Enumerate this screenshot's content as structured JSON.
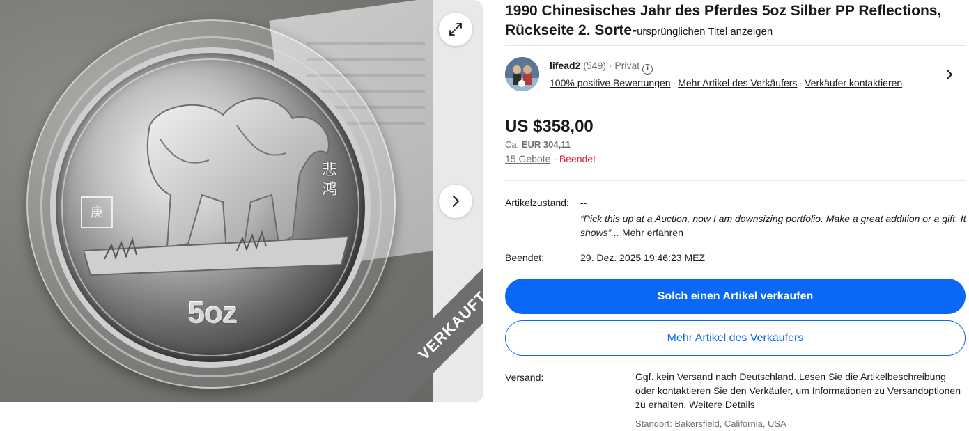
{
  "gallery": {
    "sold_ribbon": "VERKAUFT",
    "coin_weight": "5oz",
    "expand_icon": "expand-arrows-icon",
    "next_icon": "chevron-right-icon"
  },
  "listing": {
    "title": "1990 Chinesisches Jahr des Pferdes 5oz Silber PP Reflections, Rückseite 2. Sorte-",
    "show_original_title": "ursprünglichen Titel anzeigen"
  },
  "seller": {
    "name": "lifead2",
    "feedback_count": "(549)",
    "dot": " · ",
    "account_type": "Privat",
    "positive_feedback": "100% positive Bewertungen",
    "more_items": "Mehr Artikel des Verkäufers",
    "contact": "Verkäufer kontaktieren"
  },
  "price": {
    "amount": "US $358,00",
    "approx_prefix": "Ca.",
    "approx_value": "EUR 304,11",
    "bids": "15 Gebote",
    "status": "Beendet"
  },
  "details": {
    "condition_label": "Artikelzustand:",
    "condition_value": "--",
    "seller_note": "“Pick this up at a Auction, now I am downsizing portfolio. Make a great addition or a gift. It shows”",
    "ellipsis": "...",
    "learn_more": "Mehr erfahren",
    "ended_label": "Beendet:",
    "ended_value": "29. Dez. 2025 19:46:23 MEZ"
  },
  "actions": {
    "sell_similar": "Solch einen Artikel verkaufen",
    "more_from_seller": "Mehr Artikel des Verkäufers"
  },
  "shipping": {
    "label": "Versand:",
    "text_1": "Ggf. kein Versand nach Deutschland. Lesen Sie die Artikelbeschreibung oder ",
    "contact_link": "kontaktieren Sie den Verkäufer",
    "text_2": ", um Informationen zu Versandoptionen zu erhalten. ",
    "details_link": "Weitere Details",
    "location": "Standort: Bakersfield, California, USA"
  },
  "colors": {
    "primary_blue": "#0968f6",
    "ended_red": "#dd1e31",
    "muted_grey": "#707070"
  }
}
